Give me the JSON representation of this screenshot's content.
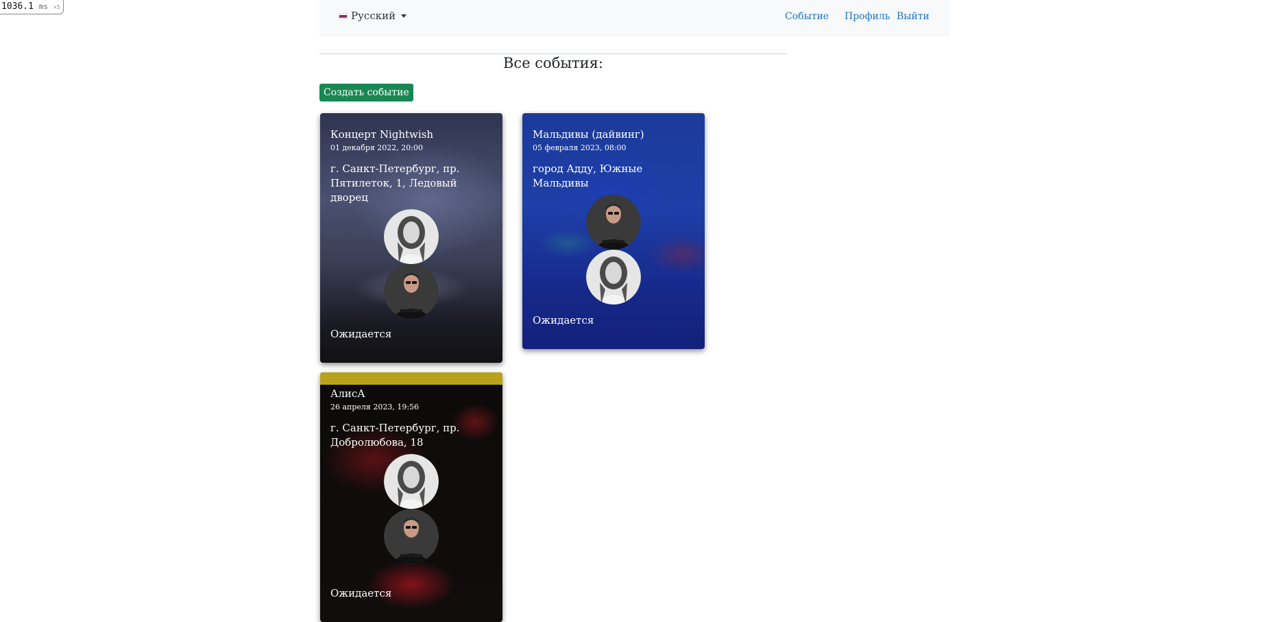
{
  "perf": {
    "value": "1036.1",
    "unit": "ms",
    "mult": "×5"
  },
  "nav": {
    "language": "Русский",
    "links": {
      "event": "Событие",
      "profile": "Профиль",
      "logout": "Выйти"
    }
  },
  "main": {
    "title": "Все события:",
    "create_button": "Создать событие"
  },
  "events": [
    {
      "title": "Концерт Nightwish",
      "date": "01 декабря 2022, 20:00",
      "address": "г. Санкт-Петербург, пр. Пятилеток, 1, Ледовый дворец",
      "status": "Ожидается"
    },
    {
      "title": "Мальдивы (дайвинг)",
      "date": "05 февраля 2023, 08:00",
      "address": "город Адду, Южные Мальдивы",
      "status": "Ожидается"
    },
    {
      "title": "АлисА",
      "date": "26 апреля 2023, 19:56",
      "address": "г. Санкт-Петербург, пр. Добролюбова, 18",
      "status": "Ожидается"
    }
  ],
  "colors": {
    "accent_link": "#1a73c9",
    "create_button": "#198754",
    "navbar_bg": "#f8f9fa"
  },
  "icons": {
    "flag": "russia-flag-icon",
    "caret": "caret-down-icon"
  }
}
